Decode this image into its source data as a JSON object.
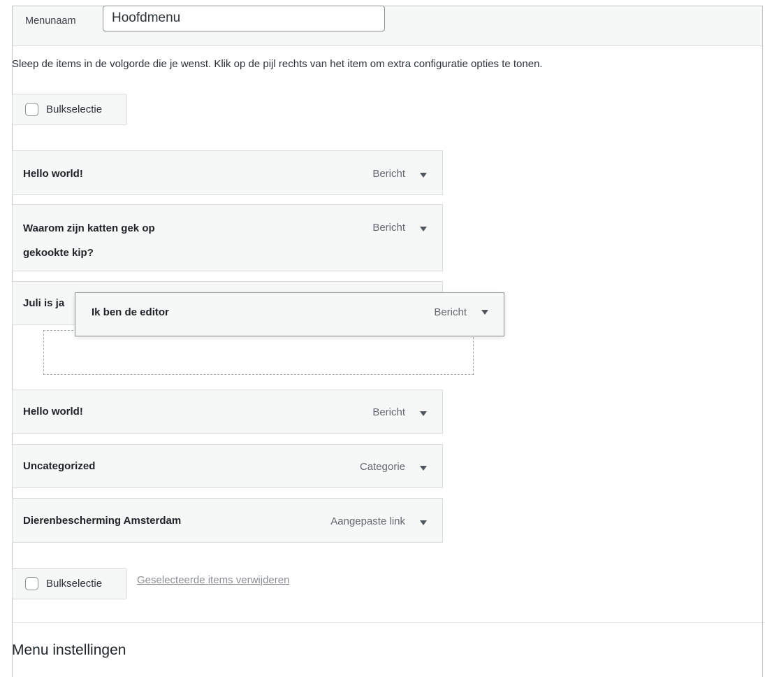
{
  "header": {
    "menu_name_label": "Menunaam",
    "menu_name_value": "Hoofdmenu"
  },
  "instructions": "Sleep de items in de volgorde die je wenst. Klik op de pijl rechts van het item om extra configuratie opties te tonen.",
  "bulk_select_label": "Bulkselectie",
  "items": [
    {
      "title": "Hello world!",
      "type": "Bericht"
    },
    {
      "title": "Waarom zijn katten gek op",
      "title_line2": "gekookte kip?",
      "type": "Bericht"
    },
    {
      "title": "Juli is ja",
      "type": ""
    },
    {
      "title": "Hello world!",
      "type": "Bericht"
    },
    {
      "title": "Uncategorized",
      "type": "Categorie"
    },
    {
      "title": "Dierenbescherming Amsterdam",
      "type": "Aangepaste link"
    }
  ],
  "dragging_item": {
    "title": "Ik ben de editor",
    "type": "Bericht"
  },
  "delete_selected_label": "Geselecteerde items verwijderen",
  "settings_title": "Menu instellingen",
  "colors": {
    "panel_bg": "#f6f7f7",
    "border": "#dcdcde",
    "text": "#1d2327",
    "muted": "#646970"
  },
  "icons": [
    "checkbox-icon",
    "chevron-down-icon"
  ]
}
